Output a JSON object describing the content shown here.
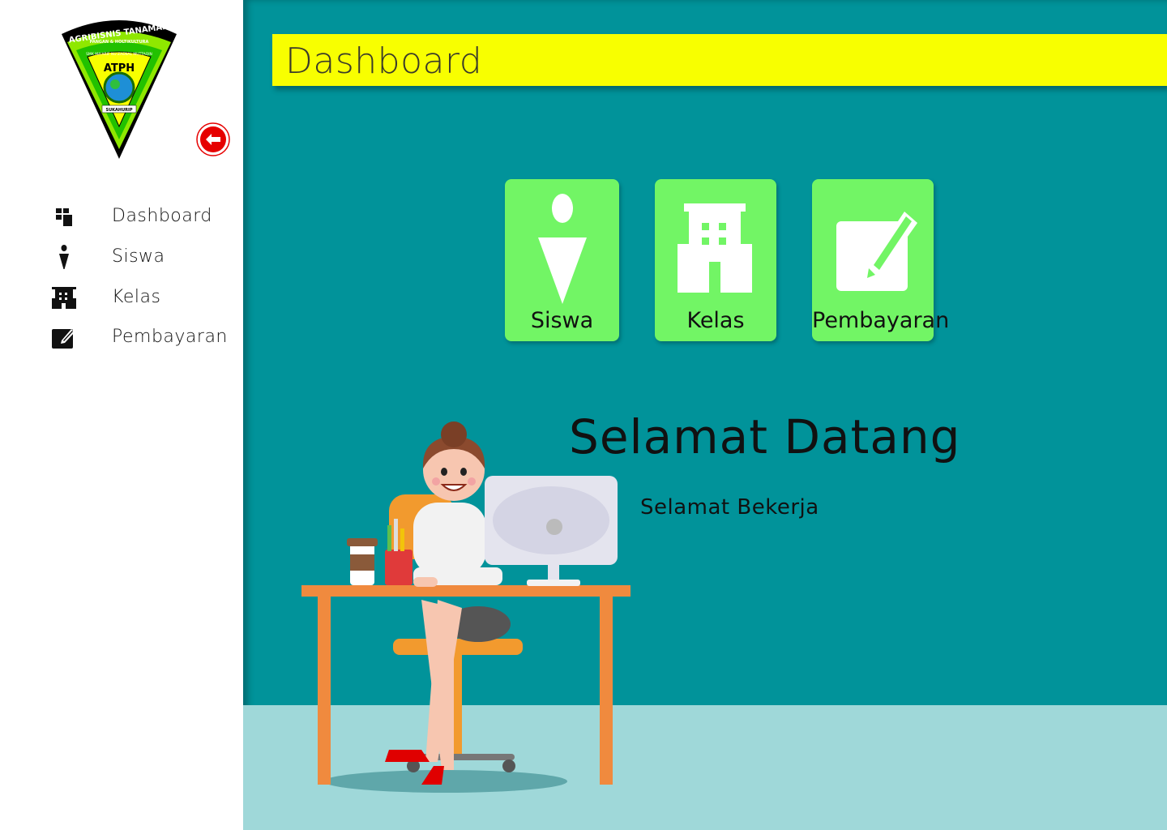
{
  "sidebar": {
    "logo": {
      "top_text": "AGRIBISNIS TANAMAN",
      "sub_text": "PANGAN & HOLTIKULTURA",
      "school_text": "SMK MA'ARIF NU ZAENAL MUTTAQIN",
      "center_text": "ATPH",
      "bottom_text": "SUKAHURIP"
    },
    "back_icon": "arrow-left-circle-icon",
    "items": [
      {
        "label": "Dashboard",
        "icon": "dashboard-icon"
      },
      {
        "label": "Siswa",
        "icon": "person-icon"
      },
      {
        "label": "Kelas",
        "icon": "building-icon"
      },
      {
        "label": "Pembayaran",
        "icon": "edit-icon"
      }
    ]
  },
  "header": {
    "title": "Dashboard"
  },
  "cards": [
    {
      "label": "Siswa",
      "icon": "person-icon"
    },
    {
      "label": "Kelas",
      "icon": "building-icon"
    },
    {
      "label": "Pembayaran",
      "icon": "edit-icon"
    }
  ],
  "welcome": {
    "title": "Selamat Datang",
    "subtitle": "Selamat Bekerja"
  },
  "colors": {
    "sidebar_bg": "#ffffff",
    "main_bg": "#01939a",
    "floor": "#9fd8d9",
    "header_bar": "#f8ff00",
    "card_bg": "#72f565",
    "back_button": "#e60000"
  }
}
